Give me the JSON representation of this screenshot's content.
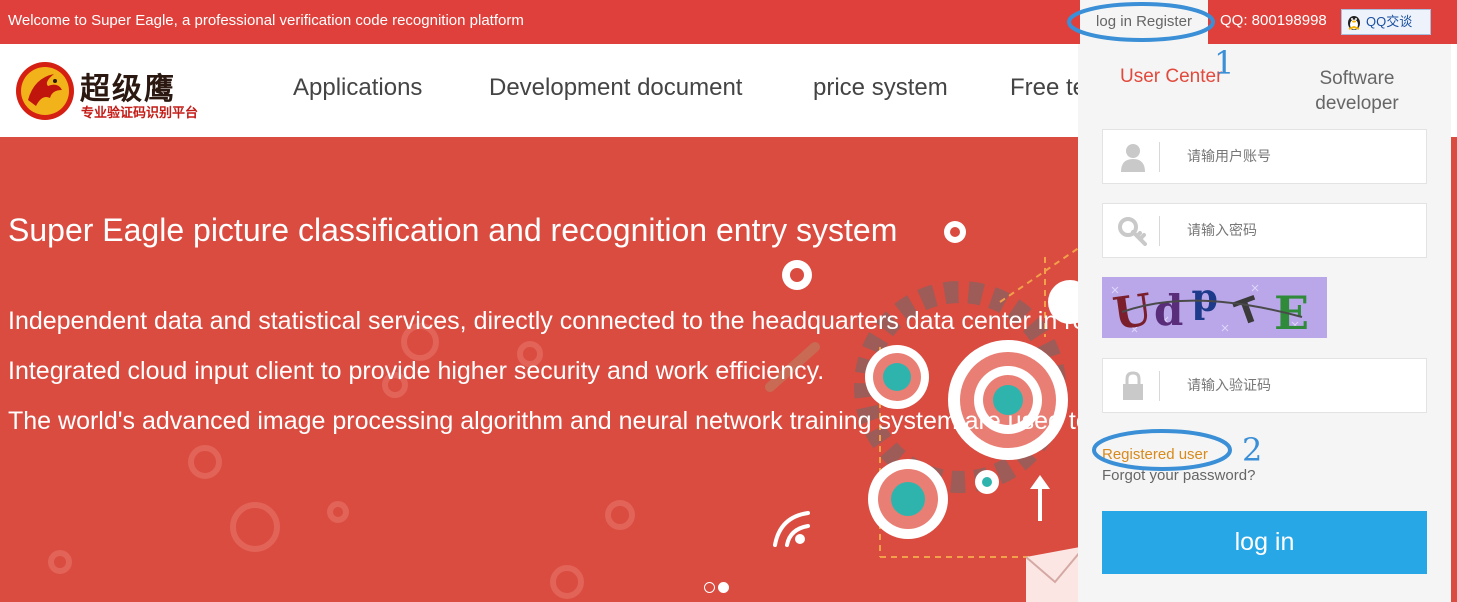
{
  "topbar": {
    "welcome": "Welcome to Super Eagle, a professional verification code recognition platform",
    "login_label": "log in",
    "register_label": "Register",
    "qq_number": "QQ: 800198998",
    "qq_button": "QQ交谈"
  },
  "logo": {
    "title_cn": "超级鹰",
    "subtitle_cn": "专业验证码识别平台"
  },
  "nav": {
    "items": [
      "Applications",
      "Development document",
      "price system",
      "Free te"
    ]
  },
  "banner": {
    "headline": "Super Eagle picture classification and recognition entry system",
    "lines": [
      "Independent data and statistical services, directly connected to the headquarters data center in re",
      "Integrated cloud input client to provide higher security and work efficiency.",
      "The world's advanced image processing algorithm and neural network training system are used to p"
    ],
    "slides_total": 2,
    "slide_active": 2
  },
  "login_panel": {
    "tabs": [
      "User Center",
      "Software developer"
    ],
    "active_tab": "User Center",
    "username_placeholder": "请输用户账号",
    "password_placeholder": "请输入密码",
    "captcha_text": "UddTE",
    "captcha_placeholder": "请输入验证码",
    "register_link": "Registered user",
    "forgot_link": "Forgot your password?",
    "login_button": "log in"
  },
  "annotations": {
    "labels": [
      "1",
      "2"
    ]
  },
  "icons": {
    "username": "user-icon",
    "password": "key-icon",
    "captcha": "lock-icon",
    "qq": "penguin-icon"
  },
  "colors": {
    "brand_red": "#e0403c",
    "banner_red": "#da4b40",
    "login_blue": "#28a7e6",
    "active_tab": "#e14a3c",
    "register_orange": "#d88a1c",
    "annotation_blue": "#3a8fd6"
  }
}
